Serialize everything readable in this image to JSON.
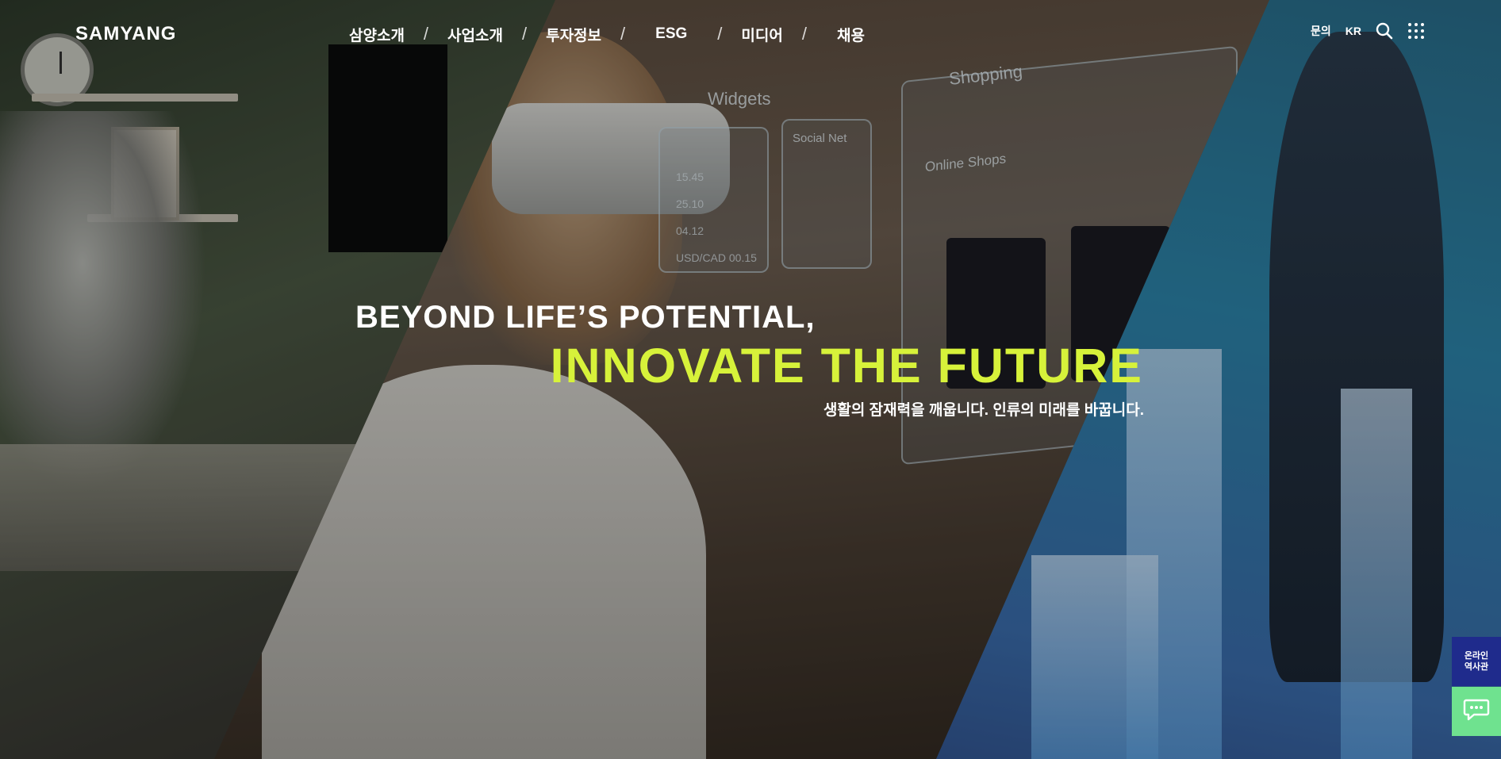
{
  "header": {
    "logo": "SAMYANG",
    "nav": [
      {
        "label": "삼양소개"
      },
      {
        "label": "사업소개"
      },
      {
        "label": "투자정보"
      },
      {
        "label": "ESG"
      },
      {
        "label": "미디어"
      },
      {
        "label": "채용"
      }
    ],
    "separator": "/",
    "contact_label": "문의",
    "lang_label": "KR",
    "icons": [
      "search-icon",
      "grid-menu-icon"
    ]
  },
  "hero": {
    "headline_1": "BEYOND LIFE’S POTENTIAL,",
    "headline_2": "INNOVATE THE FUTURE",
    "subtext": "생활의 잠재력을 깨웁니다. 인류의 미래를 바꿉니다.",
    "accent_color": "#d7f23a",
    "background_text": {
      "widgets": "Widgets",
      "social": "Social Net",
      "shopping": "Shopping",
      "online_shops": "Online Shops",
      "ticker": [
        "15.45",
        "25.10",
        "04.12",
        "USD/CAD 00.15"
      ]
    }
  },
  "floating": {
    "museum_line1": "온라인",
    "museum_line2": "역사관",
    "chat_icon": "chat-icon"
  }
}
